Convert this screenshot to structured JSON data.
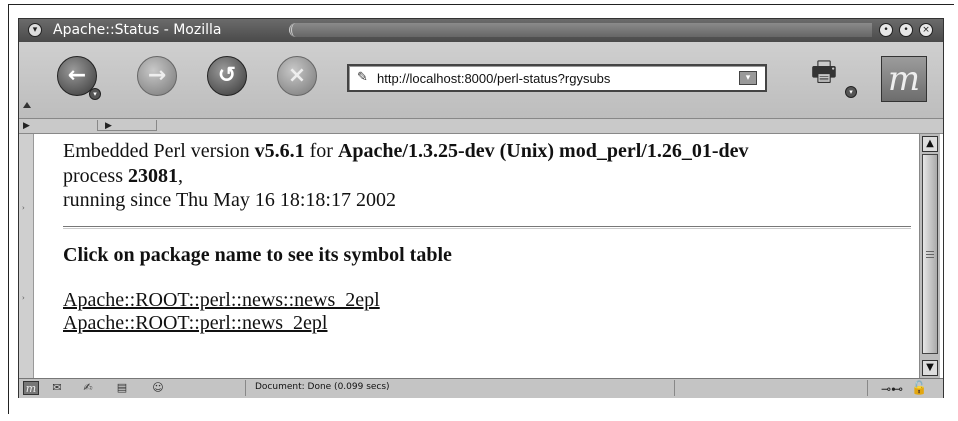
{
  "window": {
    "title": "Apache::Status - Mozilla",
    "menu_icon": "window-menu-icon",
    "controls": [
      "minimize-icon",
      "maximize-icon",
      "close-icon"
    ]
  },
  "toolbar": {
    "back_icon": "back-arrow-icon",
    "forward_icon": "forward-arrow-icon",
    "reload_icon": "reload-icon",
    "stop_icon": "stop-icon",
    "url": "http://localhost:8000/perl-status?rgysubs",
    "print_icon": "print-icon",
    "logo_icon": "mozilla-logo-icon"
  },
  "content": {
    "line1_prefix": "Embedded Perl version ",
    "perl_version": "v5.6.1",
    "line1_mid": " for ",
    "server": "Apache/1.3.25-dev (Unix) mod_perl/1.26_01-dev",
    "line2_prefix": "process ",
    "pid": "23081",
    "line2_suffix": ",",
    "line3": "running since Thu May 16 18:18:17 2002",
    "heading": "Click on package name to see its symbol table",
    "links": [
      "Apache::ROOT::perl::news::news_2epl",
      "Apache::ROOT::perl::news_2epl"
    ]
  },
  "status": {
    "text": "Document: Done (0.099 secs)"
  },
  "colors": {
    "titlebar": "#4a4a4a",
    "chrome": "#d2d2d2",
    "content_bg": "#ffffff"
  }
}
